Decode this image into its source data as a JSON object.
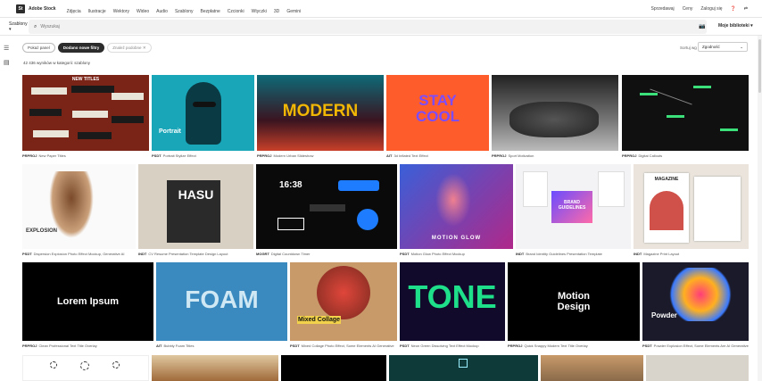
{
  "header": {
    "logo": "St",
    "brand": "Adobe Stock",
    "nav": [
      "Zdjęcia",
      "Ilustracje",
      "Wektory",
      "Wideo",
      "Audio",
      "Szablony",
      "Bezpłatne",
      "Czcionki",
      "Wtyczki",
      "3D",
      "Gemini"
    ],
    "right": [
      "Sprzedawaj",
      "Ceny",
      "Zaloguj się"
    ]
  },
  "search": {
    "filter": "Szablony",
    "placeholder": "Wyszukaj",
    "libraries": "Moje biblioteki"
  },
  "filters": {
    "show_panel": "Pokaż panel",
    "new_filters": "Dodano nowe filtry",
    "similar": "Znaleź podobne"
  },
  "sort": {
    "label": "Sortuj wg",
    "value": "Zgodność"
  },
  "result_count": "42 436 wyników w kategorii: szablony",
  "colors": {
    "accent": "#2c2c2c",
    "modern": "#f2b705",
    "stay": "#ff5c2b",
    "tone": "#1fe08a"
  },
  "tiles": [
    {
      "type": "PRPROJ",
      "caption": "New Paper Titles",
      "text": "NEW TITLES"
    },
    {
      "type": "PSDT",
      "caption": "Portrait Stylize Effect",
      "text": "Portrait"
    },
    {
      "type": "PRPROJ",
      "caption": "Modern Urban Slideshow",
      "text": "MODERN"
    },
    {
      "type": "AIT",
      "caption": "3d Inflated Text Effect",
      "text": "STAY COOL"
    },
    {
      "type": "PRPROJ",
      "caption": "Sport Motivation",
      "text": ""
    },
    {
      "type": "PRPROJ",
      "caption": "Digital Callouts",
      "text": ""
    },
    {
      "type": "PSDT",
      "caption": "Dispersion Explosion Photo Effect Mockup, Generative AI",
      "text": "EXPLOSION"
    },
    {
      "type": "INDT",
      "caption": "CV Resume Presentation Template Design Layout",
      "text": "HASU"
    },
    {
      "type": "MOGRT",
      "caption": "Digital Countdown Timer",
      "text": "16:38"
    },
    {
      "type": "PSDT",
      "caption": "Motion Glow Photo Effect Mockup",
      "text": "MOTION GLOW"
    },
    {
      "type": "INDT",
      "caption": "Brand Identity Guidelines Presentation Template",
      "text": "BRAND GUIDELINES"
    },
    {
      "type": "INDT",
      "caption": "Magazine Print Layout",
      "text": "MAGAZINE"
    },
    {
      "type": "PRPROJ",
      "caption": "Clean Professional Text Title Overlay",
      "text": "Lorem Ipsum"
    },
    {
      "type": "AIT",
      "caption": "Bubbly Foam Titles",
      "text": "FOAM"
    },
    {
      "type": "PSDT",
      "caption": "Mixed Collage Photo Effect, Some Elements AI Generative",
      "text": "Mixed Collage"
    },
    {
      "type": "PSDT",
      "caption": "Neon Green Dissolving Text Effect Mockup",
      "text": "TONE"
    },
    {
      "type": "PRPROJ",
      "caption": "Quick Snappy Modern Text Title Overlay",
      "text": "Motion Design"
    },
    {
      "type": "PSDT",
      "caption": "Powder Explosion Effect, Some Elements Are AI Generative",
      "text": "Powder"
    }
  ]
}
